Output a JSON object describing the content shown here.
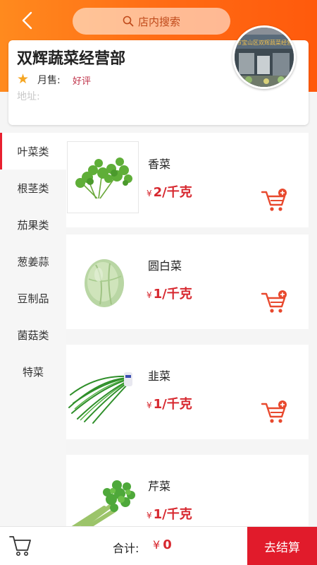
{
  "header": {
    "search_label": "店内搜索",
    "back_icon": "chevron-left-icon",
    "search_icon": "search-icon"
  },
  "shop": {
    "name": "双辉蔬菜经营部",
    "monthly_sales_label": "月售:",
    "rating_label": "好评",
    "address_label": "地址:",
    "photo_sign_text": "海市宝山区双辉蔬菜经营部"
  },
  "categories": [
    {
      "label": "叶菜类",
      "active": true
    },
    {
      "label": "根茎类",
      "active": false
    },
    {
      "label": "茄果类",
      "active": false
    },
    {
      "label": "葱姜蒜",
      "active": false
    },
    {
      "label": "豆制品",
      "active": false
    },
    {
      "label": "菌菇类",
      "active": false
    },
    {
      "label": "特菜",
      "active": false
    }
  ],
  "products": [
    {
      "name": "香菜",
      "currency": "¥",
      "price": "2/千克"
    },
    {
      "name": "圆白菜",
      "currency": "¥",
      "price": "1/千克"
    },
    {
      "name": "韭菜",
      "currency": "¥",
      "price": "1/千克"
    },
    {
      "name": "芹菜",
      "currency": "¥",
      "price": "1/千克"
    }
  ],
  "bottom": {
    "total_label": "合计:",
    "currency": "¥",
    "total_value": "0",
    "checkout_label": "去结算"
  },
  "colors": {
    "accent_orange": "#ff6a14",
    "price_red": "#d7282f",
    "checkout_red": "#e11b2b",
    "rating_red": "#c0334a",
    "star_yellow": "#f5a623"
  }
}
